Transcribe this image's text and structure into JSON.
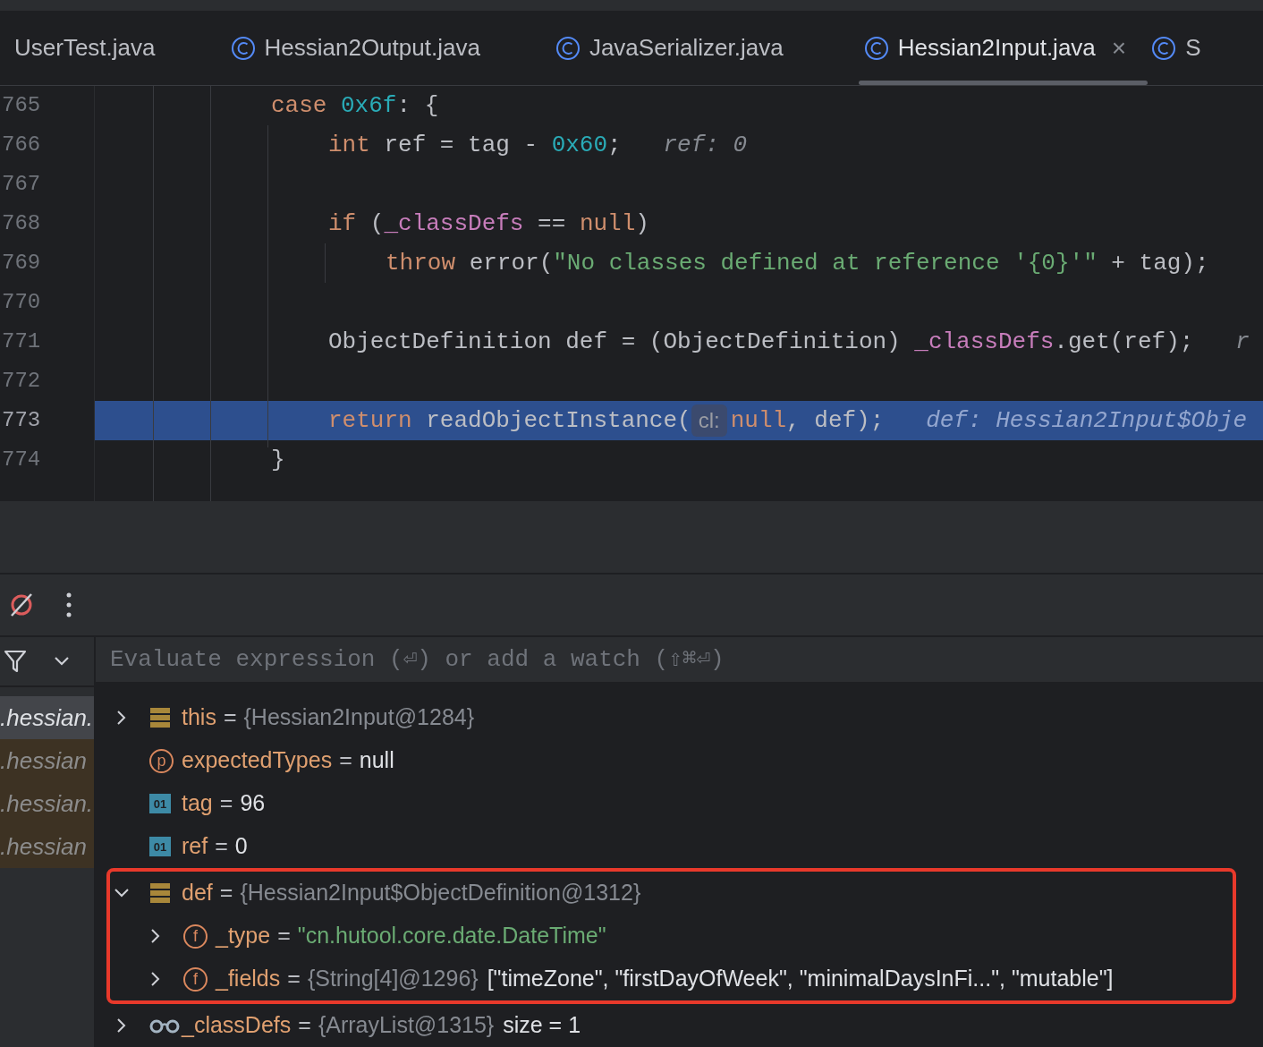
{
  "tabs": [
    {
      "label": "UserTest.java",
      "selected": false,
      "icon": false
    },
    {
      "label": "Hessian2Output.java",
      "selected": false,
      "icon": true
    },
    {
      "label": "JavaSerializer.java",
      "selected": false,
      "icon": true
    },
    {
      "label": "Hessian2Input.java",
      "selected": true,
      "icon": true,
      "close": "×"
    },
    {
      "label": "S",
      "selected": false,
      "icon": true
    }
  ],
  "editor": {
    "lines": [
      {
        "number": "765",
        "current": false,
        "kind": "case",
        "tokens": [
          {
            "kind": "kw",
            "text": "case "
          },
          {
            "kind": "num",
            "text": "0x6f"
          },
          {
            "kind": "plain",
            "text": ": {"
          }
        ]
      },
      {
        "number": "766",
        "current": false,
        "kind": "body",
        "tokens": [
          {
            "kind": "kw",
            "text": "int "
          },
          {
            "kind": "plain",
            "text": "ref = tag - "
          },
          {
            "kind": "num",
            "text": "0x60"
          },
          {
            "kind": "plain",
            "text": ";   "
          },
          {
            "kind": "hint",
            "text": "ref: 0"
          }
        ]
      },
      {
        "number": "767",
        "current": false
      },
      {
        "number": "768",
        "current": false,
        "kind": "body",
        "tokens": [
          {
            "kind": "kw",
            "text": "if "
          },
          {
            "kind": "plain",
            "text": "("
          },
          {
            "kind": "field",
            "text": "_classDefs"
          },
          {
            "kind": "plain",
            "text": " == "
          },
          {
            "kind": "kw",
            "text": "null"
          },
          {
            "kind": "plain",
            "text": ")"
          }
        ]
      },
      {
        "number": "769",
        "current": false,
        "kind": "inner",
        "tokens": [
          {
            "kind": "kw",
            "text": "throw "
          },
          {
            "kind": "plain",
            "text": "error("
          },
          {
            "kind": "str",
            "text": "\"No classes defined at reference '{0}'\""
          },
          {
            "kind": "plain",
            "text": " + tag);"
          }
        ]
      },
      {
        "number": "770",
        "current": false
      },
      {
        "number": "771",
        "current": false,
        "kind": "body",
        "tokens": [
          {
            "kind": "plain",
            "text": "ObjectDefinition def = (ObjectDefinition) "
          },
          {
            "kind": "field",
            "text": "_classDefs"
          },
          {
            "kind": "plain",
            "text": ".get(ref);   "
          },
          {
            "kind": "hint",
            "text": "r"
          }
        ]
      },
      {
        "number": "772",
        "current": false
      },
      {
        "number": "773",
        "current": true,
        "kind": "body",
        "tokens": [
          {
            "kind": "kw",
            "text": "return "
          },
          {
            "kind": "plain",
            "text": "readObjectInstance("
          },
          {
            "kind": "param",
            "text": "cl:"
          },
          {
            "kind": "kw",
            "text": "null"
          },
          {
            "kind": "plain",
            "text": ", def);   "
          },
          {
            "kind": "hint",
            "text": "def: Hessian2Input$Obje"
          }
        ]
      },
      {
        "number": "774",
        "current": false,
        "kind": "case",
        "tokens": [
          {
            "kind": "plain",
            "text": "}"
          }
        ]
      }
    ]
  },
  "debugger": {
    "frames": [
      {
        "label": ".hessian.",
        "selected": true,
        "library": false
      },
      {
        "label": ".hessian",
        "selected": false,
        "library": true
      },
      {
        "label": ".hessian.",
        "selected": false,
        "library": true
      },
      {
        "label": ".hessian",
        "selected": false,
        "library": true
      }
    ],
    "evaluate": {
      "placeholder": "Evaluate expression (⏎) or add a watch (⇧⌘⏎)"
    },
    "variables": [
      {
        "kind": "object",
        "name": "this",
        "eq": "=",
        "expanded": false,
        "highlighted": false,
        "ref": "{Hessian2Input@1284}"
      },
      {
        "kind": "param",
        "icon_text": "p",
        "name": "expectedTypes",
        "eq": "=",
        "highlighted": false,
        "value": "null"
      },
      {
        "kind": "primitive",
        "icon_text": "01",
        "name": "tag",
        "eq": "=",
        "highlighted": false,
        "value": "96"
      },
      {
        "kind": "primitive",
        "icon_text": "01",
        "name": "ref",
        "eq": "=",
        "highlighted": false,
        "value": "0"
      },
      {
        "kind": "object",
        "name": "def",
        "eq": "=",
        "expanded": true,
        "highlighted": true,
        "ref": "{Hessian2Input$ObjectDefinition@1312}",
        "children": [
          {
            "kind": "field",
            "icon_text": "f",
            "name": "_type",
            "eq": "=",
            "expanded": false,
            "highlighted": false,
            "string": "\"cn.hutool.core.date.DateTime\""
          },
          {
            "kind": "field",
            "icon_text": "f",
            "name": "_fields",
            "eq": "=",
            "expanded": false,
            "highlighted": false,
            "ref": "{String[4]@1296}",
            "value": "[\"timeZone\", \"firstDayOfWeek\", \"minimalDaysInFi...\", \"mutable\"]"
          }
        ]
      },
      {
        "kind": "watch",
        "name": "_classDefs",
        "eq": "=",
        "expanded": false,
        "highlighted": false,
        "ref": "{ArrayList@1315}",
        "value": "size = 1"
      }
    ]
  }
}
